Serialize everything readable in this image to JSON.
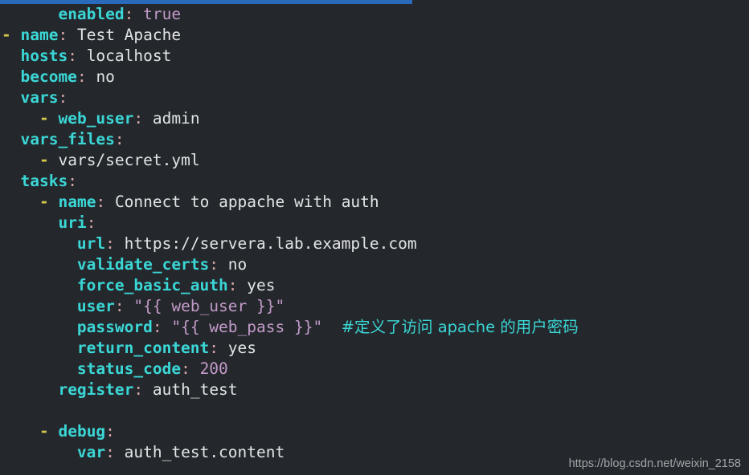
{
  "window": {
    "title": "Ansible Playbook YAML Snippet",
    "background_color": "#24282c"
  },
  "progress_bar": {
    "name": "top-progress-bar",
    "fill_color": "#2a6aba",
    "track_color": "#24282c",
    "percent": 55
  },
  "colors": {
    "key": "#3bd6d6",
    "colon": "#d9a7a7",
    "value": "#e2e4e6",
    "string": "#c39ac9",
    "dash": "#d6c84a",
    "comment": "#3bd6d6",
    "watermark": "#b4b8bb"
  },
  "code": {
    "language": "yaml",
    "lines": [
      {
        "n": 1,
        "indent": 6,
        "text": "      enabled: true",
        "tokens": [
          {
            "t": "key",
            "v": "enabled"
          },
          {
            "t": "colon",
            "v": ":"
          },
          {
            "t": "space",
            "v": " "
          },
          {
            "t": "string",
            "v": "true"
          }
        ]
      },
      {
        "n": 2,
        "indent": 0,
        "text": "- name: Test Apache",
        "tokens": [
          {
            "t": "dash",
            "v": "-"
          },
          {
            "t": "space",
            "v": " "
          },
          {
            "t": "key",
            "v": "name"
          },
          {
            "t": "colon",
            "v": ":"
          },
          {
            "t": "space",
            "v": " "
          },
          {
            "t": "value",
            "v": "Test Apache"
          }
        ]
      },
      {
        "n": 3,
        "indent": 2,
        "text": "  hosts: localhost",
        "tokens": [
          {
            "t": "key",
            "v": "hosts"
          },
          {
            "t": "colon",
            "v": ":"
          },
          {
            "t": "space",
            "v": " "
          },
          {
            "t": "value",
            "v": "localhost"
          }
        ]
      },
      {
        "n": 4,
        "indent": 2,
        "text": "  become: no",
        "tokens": [
          {
            "t": "key",
            "v": "become"
          },
          {
            "t": "colon",
            "v": ":"
          },
          {
            "t": "space",
            "v": " "
          },
          {
            "t": "value",
            "v": "no"
          }
        ]
      },
      {
        "n": 5,
        "indent": 2,
        "text": "  vars:",
        "tokens": [
          {
            "t": "key",
            "v": "vars"
          },
          {
            "t": "colon",
            "v": ":"
          }
        ]
      },
      {
        "n": 6,
        "indent": 4,
        "text": "    - web_user: admin",
        "tokens": [
          {
            "t": "dash",
            "v": "-"
          },
          {
            "t": "space",
            "v": " "
          },
          {
            "t": "key",
            "v": "web_user"
          },
          {
            "t": "colon",
            "v": ":"
          },
          {
            "t": "space",
            "v": " "
          },
          {
            "t": "value",
            "v": "admin"
          }
        ]
      },
      {
        "n": 7,
        "indent": 2,
        "text": "  vars_files:",
        "tokens": [
          {
            "t": "key",
            "v": "vars_files"
          },
          {
            "t": "colon",
            "v": ":"
          }
        ]
      },
      {
        "n": 8,
        "indent": 4,
        "text": "    - vars/secret.yml",
        "tokens": [
          {
            "t": "dash",
            "v": "-"
          },
          {
            "t": "space",
            "v": " "
          },
          {
            "t": "value",
            "v": "vars/secret.yml"
          }
        ]
      },
      {
        "n": 9,
        "indent": 2,
        "text": "  tasks:",
        "tokens": [
          {
            "t": "key",
            "v": "tasks"
          },
          {
            "t": "colon",
            "v": ":"
          }
        ]
      },
      {
        "n": 10,
        "indent": 4,
        "text": "    - name: Connect to appache with auth",
        "tokens": [
          {
            "t": "dash",
            "v": "-"
          },
          {
            "t": "space",
            "v": " "
          },
          {
            "t": "key",
            "v": "name"
          },
          {
            "t": "colon",
            "v": ":"
          },
          {
            "t": "space",
            "v": " "
          },
          {
            "t": "value",
            "v": "Connect to appache with auth"
          }
        ]
      },
      {
        "n": 11,
        "indent": 6,
        "text": "      uri:",
        "tokens": [
          {
            "t": "key",
            "v": "uri"
          },
          {
            "t": "colon",
            "v": ":"
          }
        ]
      },
      {
        "n": 12,
        "indent": 8,
        "text": "        url: https://servera.lab.example.com",
        "tokens": [
          {
            "t": "key",
            "v": "url"
          },
          {
            "t": "colon",
            "v": ":"
          },
          {
            "t": "space",
            "v": " "
          },
          {
            "t": "value",
            "v": "https://servera.lab.example.com"
          }
        ]
      },
      {
        "n": 13,
        "indent": 8,
        "text": "        validate_certs: no",
        "tokens": [
          {
            "t": "key",
            "v": "validate_certs"
          },
          {
            "t": "colon",
            "v": ":"
          },
          {
            "t": "space",
            "v": " "
          },
          {
            "t": "value",
            "v": "no"
          }
        ]
      },
      {
        "n": 14,
        "indent": 8,
        "text": "        force_basic_auth: yes",
        "tokens": [
          {
            "t": "key",
            "v": "force_basic_auth"
          },
          {
            "t": "colon",
            "v": ":"
          },
          {
            "t": "space",
            "v": " "
          },
          {
            "t": "value",
            "v": "yes"
          }
        ]
      },
      {
        "n": 15,
        "indent": 8,
        "text": "        user: \"{{ web_user }}\"",
        "tokens": [
          {
            "t": "key",
            "v": "user"
          },
          {
            "t": "colon",
            "v": ":"
          },
          {
            "t": "space",
            "v": " "
          },
          {
            "t": "string",
            "v": "\"{{ web_user }}\""
          }
        ]
      },
      {
        "n": 16,
        "indent": 8,
        "text": "        password: \"{{ web_pass }}\"  #定义了访问 apache 的用户密码",
        "tokens": [
          {
            "t": "key",
            "v": "password"
          },
          {
            "t": "colon",
            "v": ":"
          },
          {
            "t": "space",
            "v": " "
          },
          {
            "t": "string",
            "v": "\"{{ web_pass }}\""
          },
          {
            "t": "space",
            "v": "  "
          },
          {
            "t": "comment",
            "v": "#定义了访问 apache 的用户密码"
          }
        ]
      },
      {
        "n": 17,
        "indent": 8,
        "text": "        return_content: yes",
        "tokens": [
          {
            "t": "key",
            "v": "return_content"
          },
          {
            "t": "colon",
            "v": ":"
          },
          {
            "t": "space",
            "v": " "
          },
          {
            "t": "value",
            "v": "yes"
          }
        ]
      },
      {
        "n": 18,
        "indent": 8,
        "text": "        status_code: 200",
        "tokens": [
          {
            "t": "key",
            "v": "status_code"
          },
          {
            "t": "colon",
            "v": ":"
          },
          {
            "t": "space",
            "v": " "
          },
          {
            "t": "string",
            "v": "200"
          }
        ]
      },
      {
        "n": 19,
        "indent": 6,
        "text": "      register: auth_test",
        "tokens": [
          {
            "t": "key",
            "v": "register"
          },
          {
            "t": "colon",
            "v": ":"
          },
          {
            "t": "space",
            "v": " "
          },
          {
            "t": "value",
            "v": "auth_test"
          }
        ]
      },
      {
        "n": 20,
        "indent": 0,
        "text": "",
        "tokens": []
      },
      {
        "n": 21,
        "indent": 4,
        "text": "    - debug:",
        "tokens": [
          {
            "t": "dash",
            "v": "-"
          },
          {
            "t": "space",
            "v": " "
          },
          {
            "t": "key",
            "v": "debug"
          },
          {
            "t": "colon",
            "v": ":"
          }
        ]
      },
      {
        "n": 22,
        "indent": 8,
        "text": "        var: auth_test.content",
        "tokens": [
          {
            "t": "key",
            "v": "var"
          },
          {
            "t": "colon",
            "v": ":"
          },
          {
            "t": "space",
            "v": " "
          },
          {
            "t": "value",
            "v": "auth_test.content"
          }
        ]
      }
    ]
  },
  "watermark": {
    "text": "https://blog.csdn.net/weixin_2158"
  }
}
